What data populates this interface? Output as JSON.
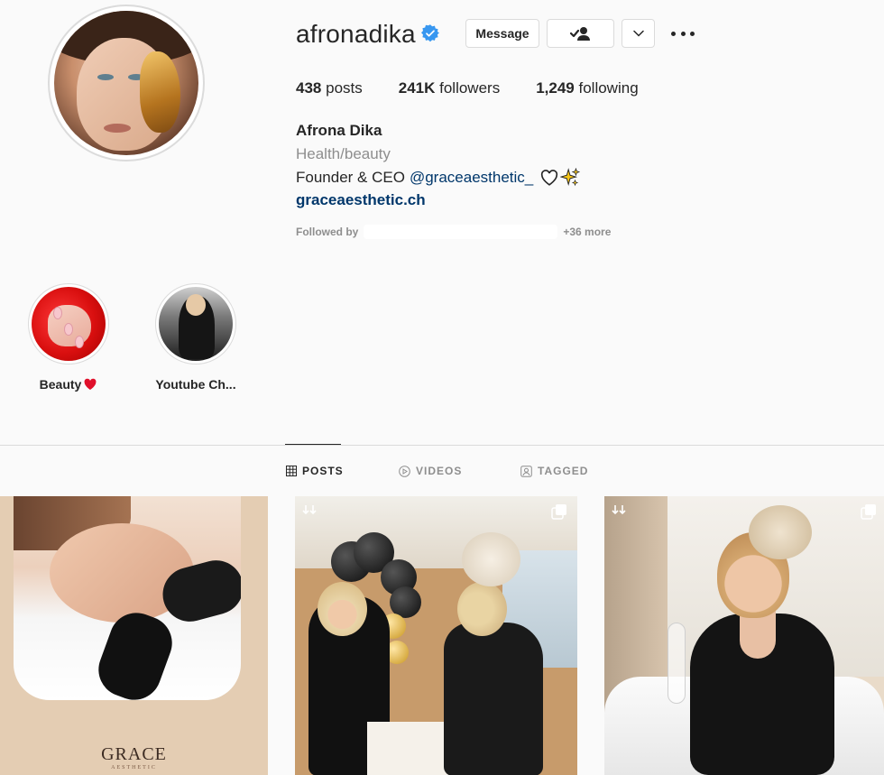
{
  "profile": {
    "username": "afronadika",
    "full_name": "Afrona Dika",
    "category": "Health/beauty",
    "bio_text": "Founder & CEO",
    "bio_mention": "@graceaesthetic_",
    "website": "graceaesthetic.ch",
    "followed_by_label": "Followed by",
    "followed_by_more": "+36 more"
  },
  "buttons": {
    "message": "Message"
  },
  "stats": {
    "posts_count": "438",
    "posts_label": "posts",
    "followers_count": "241K",
    "followers_label": "followers",
    "following_count": "1,249",
    "following_label": "following"
  },
  "highlights": [
    {
      "label": "Beauty"
    },
    {
      "label": "Youtube Ch..."
    }
  ],
  "tabs": [
    {
      "label": "POSTS",
      "active": true
    },
    {
      "label": "VIDEOS",
      "active": false
    },
    {
      "label": "TAGGED",
      "active": false
    }
  ],
  "posts": [
    {
      "logo_text": "GRACE",
      "logo_sub": "AESTHETIC"
    },
    {},
    {}
  ],
  "colors": {
    "link": "#00376b",
    "verified": "#3897f0",
    "muted": "#8e8e8e",
    "text": "#262626"
  }
}
